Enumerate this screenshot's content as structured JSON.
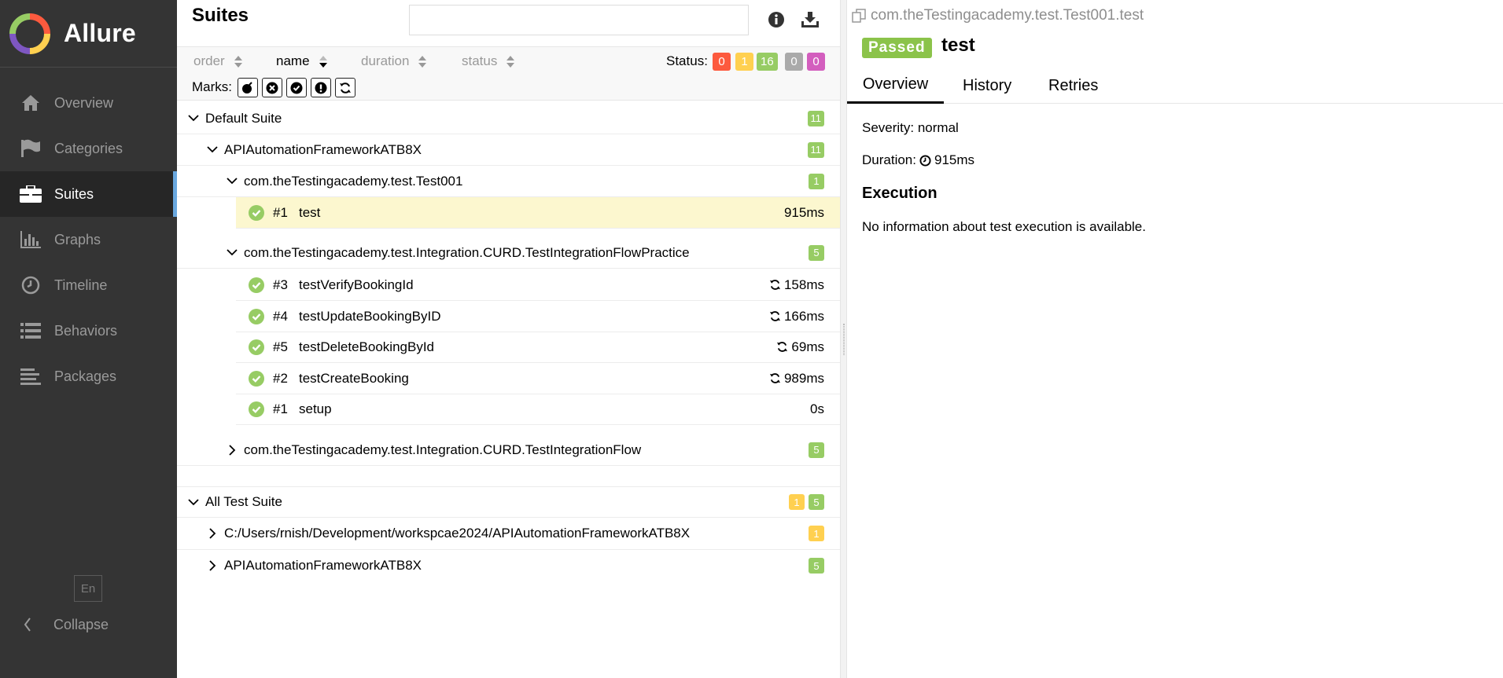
{
  "app": {
    "name": "Allure"
  },
  "sidebar": {
    "items": [
      {
        "label": "Overview",
        "icon": "home-icon"
      },
      {
        "label": "Categories",
        "icon": "flag-icon"
      },
      {
        "label": "Suites",
        "icon": "briefcase-icon",
        "active": true
      },
      {
        "label": "Graphs",
        "icon": "bar-chart-icon"
      },
      {
        "label": "Timeline",
        "icon": "clock-icon"
      },
      {
        "label": "Behaviors",
        "icon": "list-icon"
      },
      {
        "label": "Packages",
        "icon": "align-left-icon"
      }
    ],
    "language": "En",
    "collapse_label": "Collapse"
  },
  "suites": {
    "title": "Suites",
    "search_value": "",
    "sort": {
      "order": "order",
      "name": "name",
      "duration": "duration",
      "status": "status"
    },
    "status_label": "Status:",
    "status_counts": {
      "failed": "0",
      "broken": "1",
      "passed": "16",
      "skipped": "0",
      "unknown": "0"
    },
    "marks_label": "Marks:",
    "tree": {
      "default_suite": {
        "label": "Default Suite",
        "count": "11"
      },
      "project": {
        "label": "APIAutomationFrameworkATB8X",
        "count": "11"
      },
      "class1": {
        "label": "com.theTestingacademy.test.Test001",
        "count": "1"
      },
      "test1": {
        "num": "#1",
        "name": "test",
        "duration": "915ms"
      },
      "class2": {
        "label": "com.theTestingacademy.test.Integration.CURD.TestIntegrationFlowPractice",
        "count": "5"
      },
      "tests2": [
        {
          "num": "#3",
          "name": "testVerifyBookingId",
          "duration": "158ms",
          "retry": true
        },
        {
          "num": "#4",
          "name": "testUpdateBookingByID",
          "duration": "166ms",
          "retry": true
        },
        {
          "num": "#5",
          "name": "testDeleteBookingById",
          "duration": "69ms",
          "retry": true
        },
        {
          "num": "#2",
          "name": "testCreateBooking",
          "duration": "989ms",
          "retry": true
        },
        {
          "num": "#1",
          "name": "setup",
          "duration": "0s",
          "retry": false
        }
      ],
      "class3": {
        "label": "com.theTestingacademy.test.Integration.CURD.TestIntegrationFlow",
        "count": "5"
      },
      "all_suite": {
        "label": "All Test Suite",
        "count_broken": "1",
        "count_passed": "5"
      },
      "all_child1": {
        "label": "C:/Users/rnish/Development/workspcae2024/APIAutomationFrameworkATB8X",
        "count": "1"
      },
      "all_child2": {
        "label": "APIAutomationFrameworkATB8X",
        "count": "5"
      }
    }
  },
  "detail": {
    "path": "com.theTestingacademy.test.Test001.test",
    "status": "Passed",
    "title": "test",
    "tabs": [
      "Overview",
      "History",
      "Retries"
    ],
    "severity_line": "Severity: normal",
    "duration_label": "Duration:",
    "duration_value": "915ms",
    "execution_title": "Execution",
    "execution_text": "No information about test execution is available."
  },
  "colors": {
    "failed": "#fd5a3e",
    "broken": "#ffd050",
    "passed": "#97cc64",
    "skipped": "#aaaaaa",
    "unknown": "#d35ebe",
    "accent": "#6aa8df",
    "sidebar": "#343434"
  }
}
